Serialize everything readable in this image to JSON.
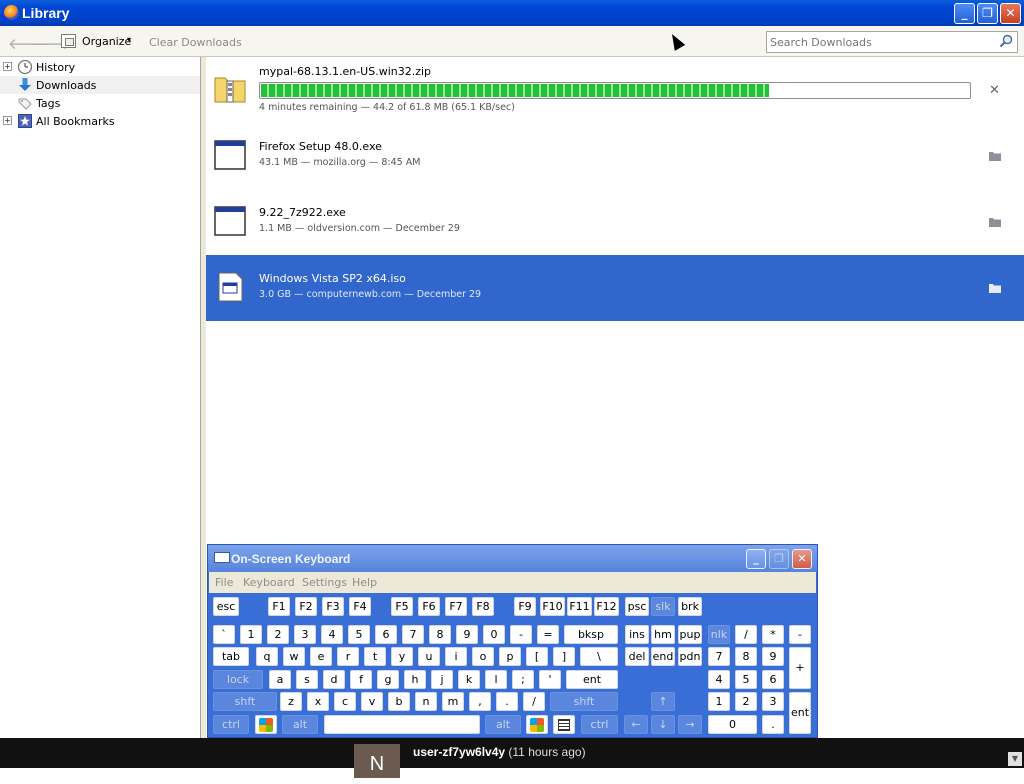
{
  "window": {
    "title": "Library",
    "minimize": "_",
    "maximize": "❐",
    "close": "✕"
  },
  "toolbar": {
    "back": "🡐",
    "forward": "🡒",
    "organize_label": "Organize",
    "organize_arrow": "▾",
    "clear_label": "Clear Downloads",
    "search_placeholder": "Search Downloads"
  },
  "sidebar": {
    "items": [
      {
        "label": "History",
        "icon": "clock-icon",
        "expander": "+"
      },
      {
        "label": "Downloads",
        "icon": "download-arrow-icon",
        "expander": ""
      },
      {
        "label": "Tags",
        "icon": "tag-icon",
        "expander": ""
      },
      {
        "label": "All Bookmarks",
        "icon": "bookmarks-star-icon",
        "expander": "+"
      }
    ]
  },
  "downloads": [
    {
      "name": "mypal-68.13.1.en-US.win32.zip",
      "meta": "4 minutes remaining — 44.2 of 61.8 MB (65.1 KB/sec)",
      "progress": 0.715,
      "action": "✕",
      "icon": "zip-folder-icon"
    },
    {
      "name": "Firefox Setup 48.0.exe",
      "meta": "43.1 MB — mozilla.org — 8:45 AM",
      "icon": "exe-window-icon"
    },
    {
      "name": "9.22_7z922.exe",
      "meta": "1.1 MB — oldversion.com — December 29",
      "icon": "exe-window-icon"
    },
    {
      "name": "Windows Vista SP2 x64.iso",
      "meta": "3.0 GB — computernewb.com — December 29",
      "icon": "iso-disc-icon"
    }
  ],
  "osk": {
    "title": "On-Screen Keyboard",
    "menu": [
      "File",
      "Keyboard",
      "Settings",
      "Help"
    ],
    "keys": {
      "esc": "esc",
      "f1": "F1",
      "f2": "F2",
      "f3": "F3",
      "f4": "F4",
      "f5": "F5",
      "f6": "F6",
      "f7": "F7",
      "f8": "F8",
      "f9": "F9",
      "f10": "F10",
      "f11": "F11",
      "f12": "F12",
      "psc": "psc",
      "slk": "slk",
      "brk": "brk",
      "row1": [
        "`",
        "1",
        "2",
        "3",
        "4",
        "5",
        "6",
        "7",
        "8",
        "9",
        "0",
        "-",
        "="
      ],
      "bksp": "bksp",
      "ins": "ins",
      "hm": "hm",
      "pup": "pup",
      "nlk": "nlk",
      "div": "/",
      "mul": "*",
      "sub": "-",
      "tab": "tab",
      "row2": [
        "q",
        "w",
        "e",
        "r",
        "t",
        "y",
        "u",
        "i",
        "o",
        "p",
        "[",
        "]",
        "\\"
      ],
      "del": "del",
      "end": "end",
      "pdn": "pdn",
      "n7": "7",
      "n8": "8",
      "n9": "9",
      "add": "+",
      "lock": "lock",
      "row3": [
        "a",
        "s",
        "d",
        "f",
        "g",
        "h",
        "j",
        "k",
        "l",
        ";",
        "'"
      ],
      "ent": "ent",
      "n4": "4",
      "n5": "5",
      "n6": "6",
      "shft": "shft",
      "row4": [
        "z",
        "x",
        "c",
        "v",
        "b",
        "n",
        "m",
        ",",
        ".",
        "/"
      ],
      "up": "↑",
      "n1": "1",
      "n2": "2",
      "n3": "3",
      "nent": "ent",
      "ctrl": "ctrl",
      "alt": "alt",
      "left": "←",
      "down": "↓",
      "right": "→",
      "n0": "0",
      "ndot": "."
    }
  },
  "notification": {
    "avatar_letter": "N",
    "user": "user-zf7yw6lv4y",
    "time": "(11 hours ago)"
  }
}
